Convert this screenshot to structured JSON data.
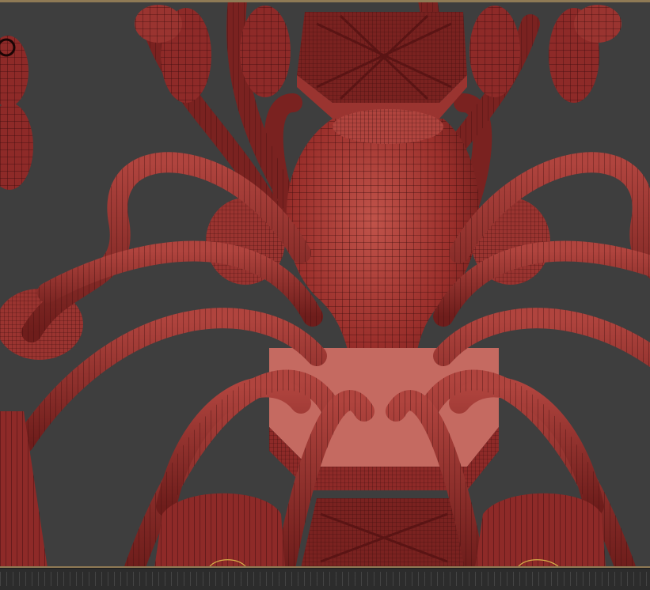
{
  "app": {
    "view": "perspective-viewport"
  },
  "scene": {
    "model": "chandelier-wireframe-mesh",
    "colors": {
      "background": "#3e3e3e",
      "mesh": "#8e2a28",
      "mesh_dark": "#5c1716",
      "mesh_light": "#b84a44",
      "wire": "#3a0c0c",
      "inner": "#c56a61",
      "frame": "#8f7a55",
      "helper": "#d8b24a"
    }
  }
}
